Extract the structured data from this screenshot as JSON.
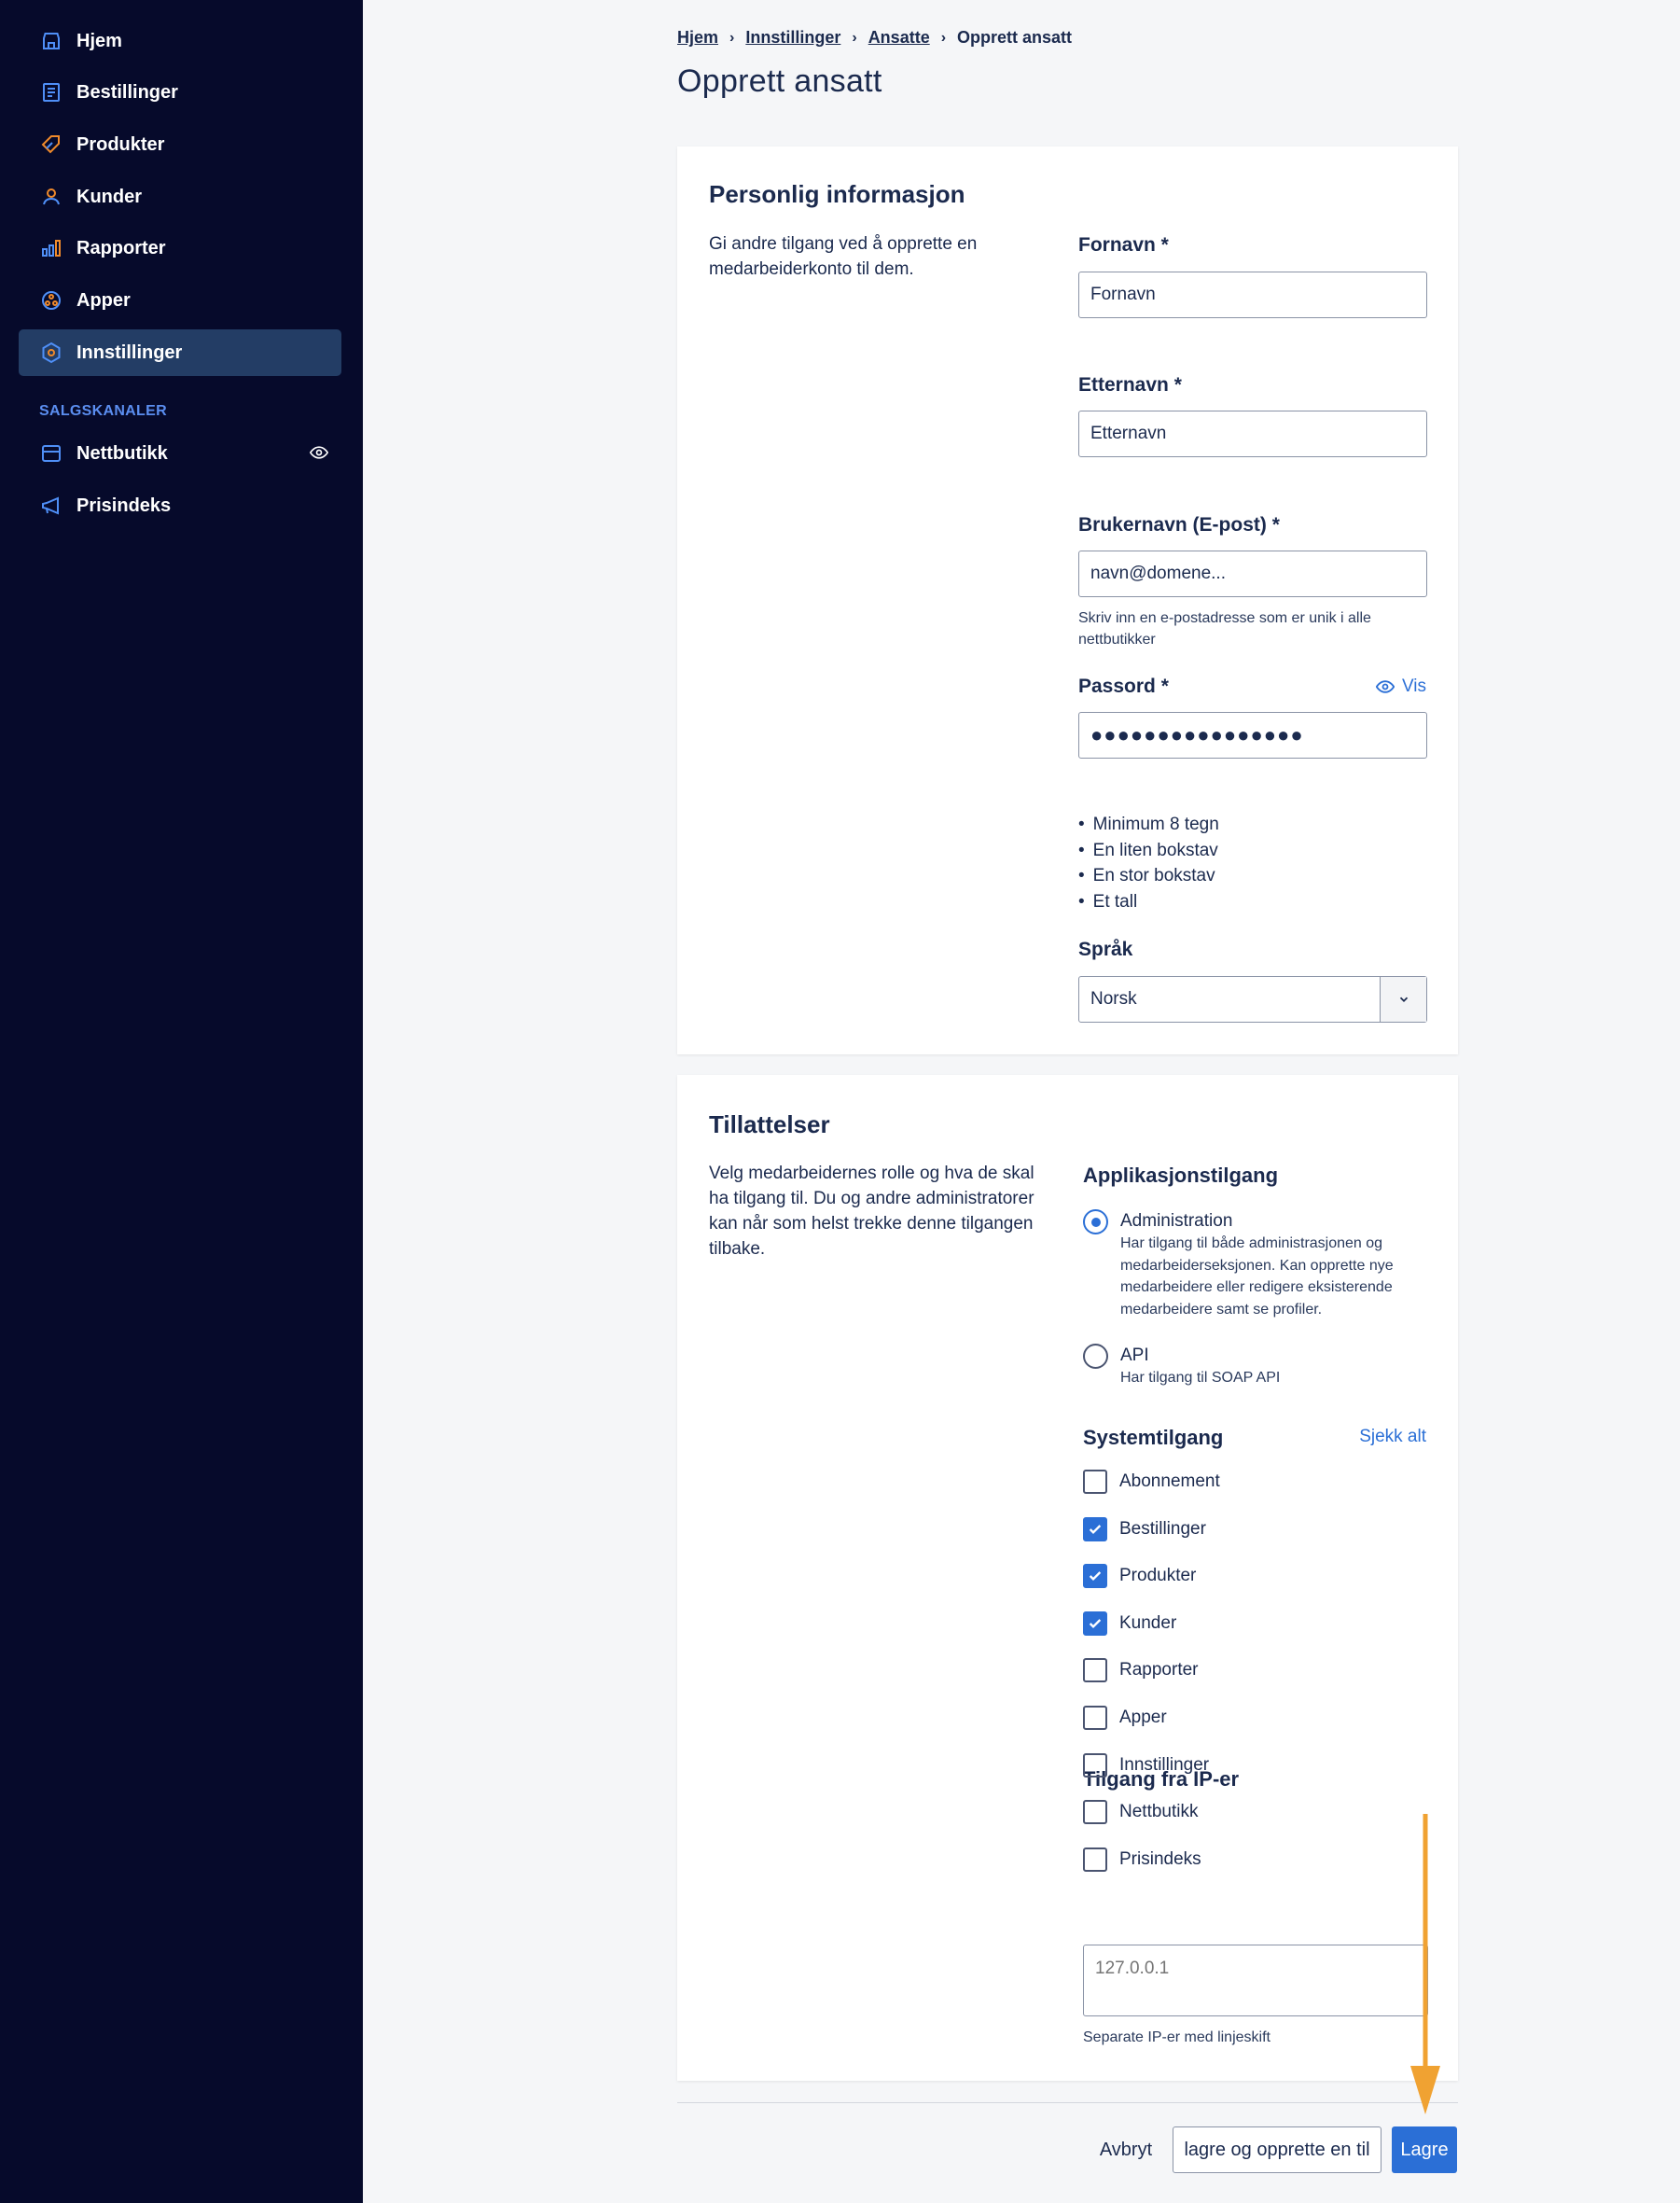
{
  "sidebar": {
    "items": [
      {
        "label": "Hjem",
        "icon": "store-icon"
      },
      {
        "label": "Bestillinger",
        "icon": "orders-icon"
      },
      {
        "label": "Produkter",
        "icon": "tag-icon"
      },
      {
        "label": "Kunder",
        "icon": "user-icon"
      },
      {
        "label": "Rapporter",
        "icon": "bar-chart-icon"
      },
      {
        "label": "Apper",
        "icon": "apps-icon"
      },
      {
        "label": "Innstillinger",
        "icon": "gear-icon",
        "active": true
      }
    ],
    "section_label": "SALGSKANALER",
    "channels": [
      {
        "label": "Nettbutikk",
        "icon": "shop-icon"
      },
      {
        "label": "Prisindeks",
        "icon": "megaphone-icon"
      }
    ]
  },
  "breadcrumb": [
    "Hjem",
    "Innstillinger",
    "Ansatte",
    "Opprett ansatt"
  ],
  "page_title": "Opprett ansatt",
  "personal": {
    "title": "Personlig informasjon",
    "description": "Gi andre tilgang ved å opprette en medarbeiderkonto til dem.",
    "first_name": {
      "label": "Fornavn *",
      "placeholder": "Fornavn"
    },
    "last_name": {
      "label": "Etternavn *",
      "placeholder": "Etternavn"
    },
    "username": {
      "label": "Brukernavn (E-post) *",
      "placeholder": "navn@domene...",
      "help": "Skriv inn en e-postadresse som er unik i alle nettbutikker"
    },
    "password": {
      "label": "Passord *",
      "show_label": "Vis",
      "value": "●●●●●●●●●●●●●●●●"
    },
    "password_rules": [
      "Minimum 8 tegn",
      "En liten bokstav",
      "En stor bokstav",
      "Et tall"
    ],
    "language": {
      "label": "Språk",
      "value": "Norsk"
    }
  },
  "permissions": {
    "title": "Tillattelser",
    "description": "Velg medarbeidernes rolle og hva de skal ha tilgang til. Du og andre administratorer kan når som helst trekke denne tilgangen tilbake.",
    "app_access": {
      "title": "Applikasjonstilgang",
      "options": [
        {
          "label": "Administration",
          "desc": "Har tilgang til både administrasjonen og medarbeiderseksjonen. Kan opprette nye medarbeidere eller redigere eksisterende medarbeidere samt se profiler.",
          "selected": true
        },
        {
          "label": "API",
          "desc": "Har tilgang til SOAP API",
          "selected": false
        }
      ]
    },
    "system_access": {
      "title": "Systemtilgang",
      "check_all": "Sjekk alt",
      "items": [
        {
          "label": "Abonnement",
          "checked": false
        },
        {
          "label": "Bestillinger",
          "checked": true
        },
        {
          "label": "Produkter",
          "checked": true
        },
        {
          "label": "Kunder",
          "checked": true
        },
        {
          "label": "Rapporter",
          "checked": false
        },
        {
          "label": "Apper",
          "checked": false
        },
        {
          "label": "Innstillinger",
          "checked": false
        },
        {
          "label": "Nettbutikk",
          "checked": false
        },
        {
          "label": "Prisindeks",
          "checked": false
        }
      ]
    },
    "ip_access": {
      "title": "Tilgang fra IP-er",
      "placeholder": "127.0.0.1",
      "help": "Separate IP-er med linjeskift"
    }
  },
  "actions": {
    "cancel": "Avbryt",
    "save_and_new": "lagre og opprette en til",
    "save": "Lagre"
  },
  "colors": {
    "sidebar_bg": "#060a2b",
    "accent": "#2b6fd6",
    "annotation_arrow": "#f0a232"
  }
}
